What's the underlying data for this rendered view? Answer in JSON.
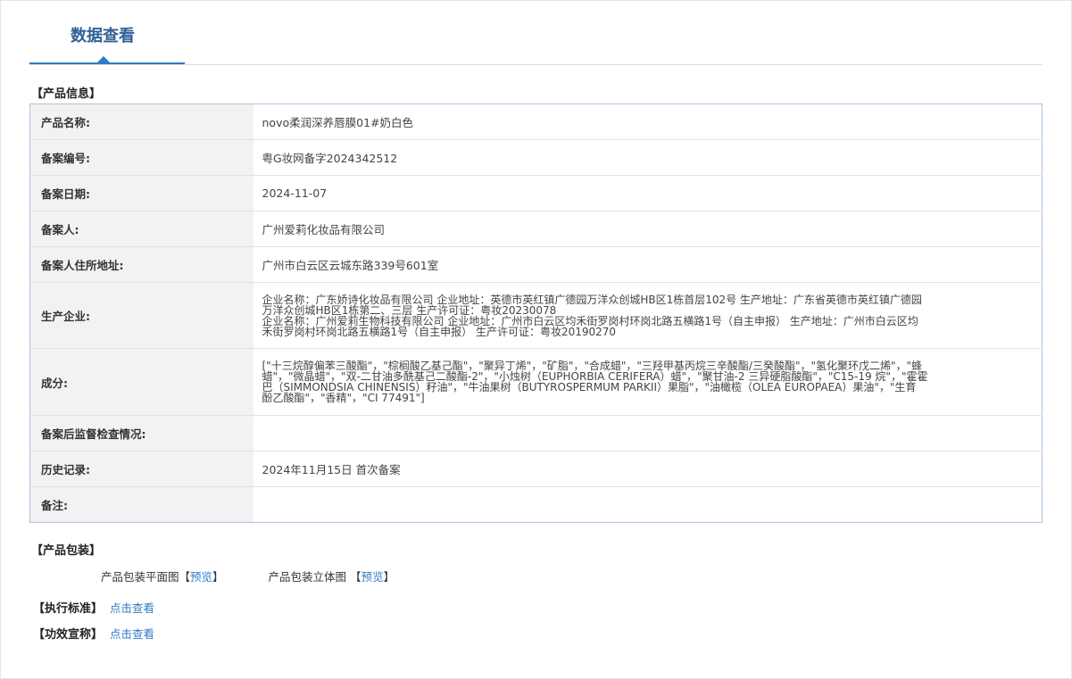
{
  "header": {
    "tab_title": "数据查看"
  },
  "product_info": {
    "section_title": "【产品信息】",
    "rows": [
      {
        "label": "产品名称:",
        "value": "novo柔润深养唇膜01#奶白色"
      },
      {
        "label": "备案编号:",
        "value": "粤G妆网备字2024342512"
      },
      {
        "label": "备案日期:",
        "value": "2024-11-07"
      },
      {
        "label": "备案人:",
        "value": "广州爱莉化妆品有限公司"
      },
      {
        "label": "备案人住所地址:",
        "value": "广州市白云区云城东路339号601室"
      }
    ],
    "manufacturer": {
      "label": "生产企业:",
      "lines": [
        "企业名称：广东娇诗化妆品有限公司 企业地址：英德市英红镇广德园万洋众创城HB区1栋首层102号 生产地址：广东省英德市英红镇广德园",
        "万洋众创城HB区1栋第二、三层 生产许可证：粤妆20230078",
        "企业名称：广州爱莉生物科技有限公司 企业地址：广州市白云区均禾街罗岗村环岗北路五横路1号（自主申报） 生产地址：广州市白云区均",
        "禾街罗岗村环岗北路五横路1号（自主申报） 生产许可证：粤妆20190270"
      ]
    },
    "ingredients": {
      "label": "成分:",
      "lines": [
        "[\"十三烷醇偏苯三酸酯\"，\"棕榈酸乙基己酯\"，\"聚异丁烯\"，\"矿脂\"，\"合成蜡\"，\"三羟甲基丙烷三辛酸酯/三癸酸酯\"，\"氢化聚环戊二烯\"，\"蜂",
        "蜡\"，\"微晶蜡\"，\"双-二甘油多酰基己二酸酯-2\"，\"小烛树（EUPHORBIA CERIFERA）蜡\"，\"聚甘油-2 三异硬脂酸酯\"，\"C15-19 烷\"，\"霍霍",
        "巴（SIMMONDSIA CHINENSIS）籽油\"，\"牛油果树（BUTYROSPERMUM PARKII）果脂\"，\"油橄榄（OLEA EUROPAEA）果油\"，\"生育",
        "酚乙酸酯\"，\"香精\"，\"CI 77491\"]"
      ]
    },
    "supervision": {
      "label": "备案后监督检查情况:",
      "value": ""
    },
    "history": {
      "label": "历史记录:",
      "value": "2024年11月15日 首次备案"
    },
    "remarks": {
      "label": "备注:",
      "value": ""
    }
  },
  "packaging": {
    "section_title": "【产品包装】",
    "flat_label": "产品包装平面图",
    "flat_link": "预览",
    "solid_label": "产品包装立体图",
    "solid_link": "预览",
    "bracket_open": "【",
    "bracket_close": "】"
  },
  "standard": {
    "label": "【执行标准】",
    "link": "点击查看"
  },
  "efficacy": {
    "label": "【功效宣称】",
    "link": "点击查看"
  }
}
